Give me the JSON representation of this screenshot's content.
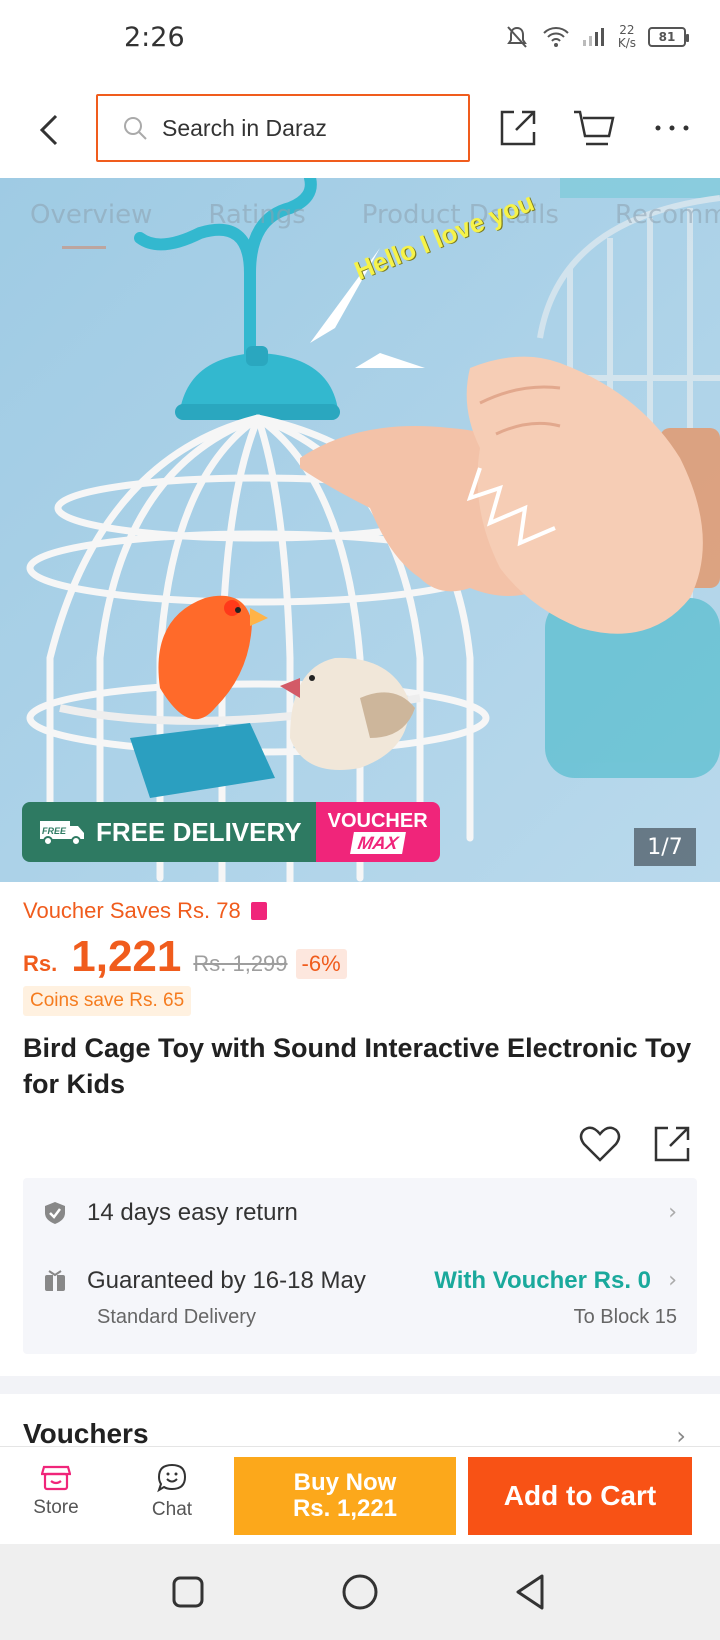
{
  "status_bar": {
    "time": "2:26",
    "net_speed_value": "22",
    "net_speed_unit": "K/s",
    "battery": "81"
  },
  "header": {
    "search_placeholder": "Search in Daraz",
    "accent_color": "#f05c1d"
  },
  "gallery": {
    "tabs": [
      "Overview",
      "Ratings",
      "Product Details",
      "Recommended"
    ],
    "caption": "Hello I love you",
    "badge_free_tag": "FREE",
    "badge_free_delivery": "FREE DELIVERY",
    "badge_voucher_line1": "VOUCHER",
    "badge_voucher_line2": "MAX",
    "counter": "1/7"
  },
  "product": {
    "voucher_saves": "Voucher Saves Rs. 78",
    "currency": "Rs.",
    "price": "1,221",
    "original_price": "Rs. 1,299",
    "discount": "-6%",
    "coins_save": "Coins save Rs. 65",
    "title": "Bird Cage Toy with Sound Interactive Electronic Toy for Kids"
  },
  "services": {
    "return_label": "14 days easy return",
    "delivery_label": "Guaranteed by 16-18 May",
    "delivery_voucher": "With Voucher Rs. 0",
    "delivery_type": "Standard Delivery",
    "delivery_location": "To Block 15"
  },
  "vouchers_section": {
    "title": "Vouchers"
  },
  "bottom_bar": {
    "store_label": "Store",
    "chat_label": "Chat",
    "buy_now_line1": "Buy Now",
    "buy_now_line2": "Rs. 1,221",
    "add_to_cart": "Add to Cart"
  }
}
